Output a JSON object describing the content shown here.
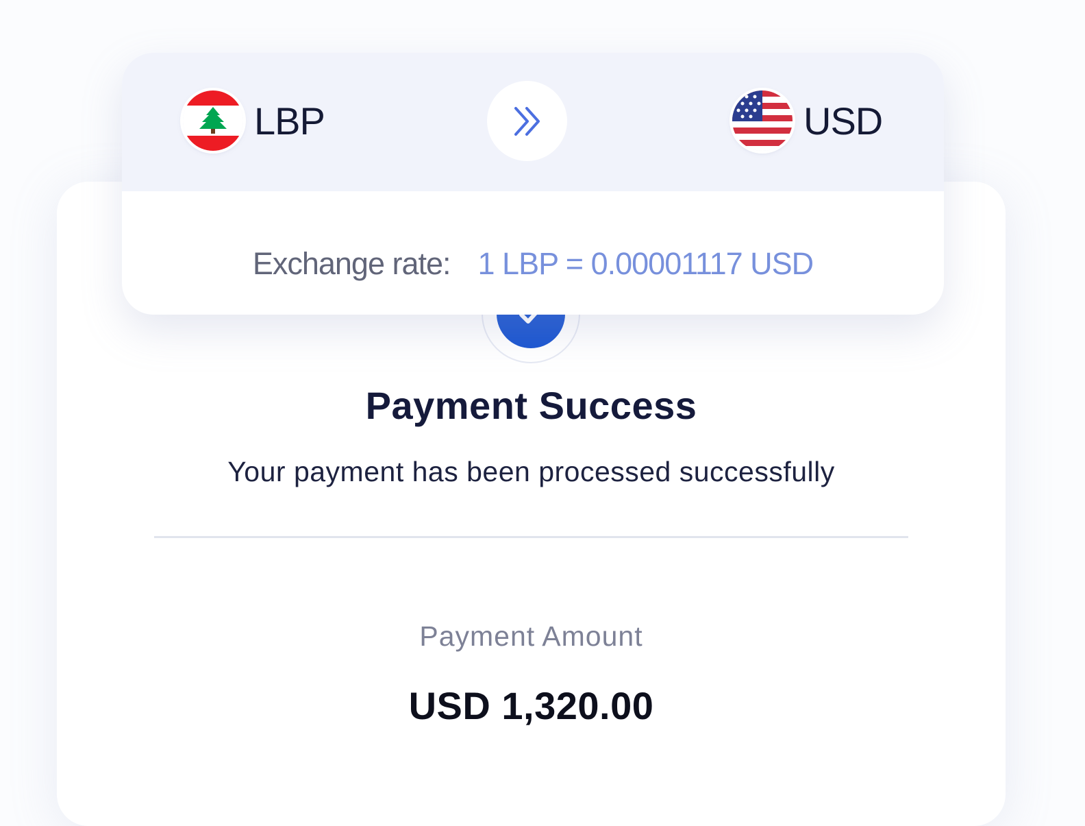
{
  "exchange": {
    "from": {
      "code": "LBP",
      "flag_icon": "lebanon-flag-icon"
    },
    "to": {
      "code": "USD",
      "flag_icon": "usa-flag-icon"
    },
    "swap_icon": "double-chevron-right-icon",
    "rate_label": "Exchange rate:",
    "rate_value": "1 LBP = 0.00001117 USD"
  },
  "payment": {
    "status_icon": "check-icon",
    "title": "Payment Success",
    "subtitle": "Your payment has been processed successfully",
    "amount_label": "Payment Amount",
    "amount_value": "USD 1,320.00"
  },
  "colors": {
    "accent_blue": "#1b56d1",
    "rate_blue": "#7790dc",
    "header_bg": "#f1f3fb",
    "title_text": "#151a3b"
  }
}
